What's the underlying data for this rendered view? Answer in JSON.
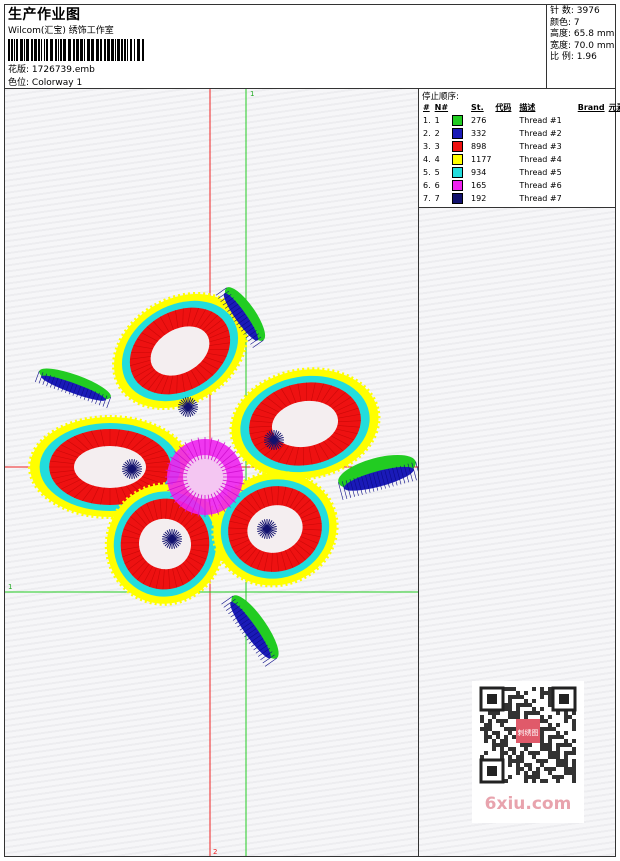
{
  "header": {
    "title": "生产作业图",
    "company": "Wilcom(汇宝) 绣饰工作室",
    "design_label": "花版:",
    "design_value": "1726739.emb",
    "color_label": "色位:",
    "color_value": "Colorway 1"
  },
  "stats": {
    "stitches_label": "针 数:",
    "stitches": "3976",
    "colors_label": "颜色:",
    "colors": "7",
    "height_label": "高度:",
    "height": "65.8 mm",
    "width_label": "宽度:",
    "width": "70.0 mm",
    "scale_label": "比 例:",
    "scale": "1.96"
  },
  "stop_sequence": {
    "title": "停止顺序:",
    "columns": [
      "#",
      "N#",
      "St.",
      "代码",
      "描述",
      "Brand",
      "元素"
    ],
    "rows": [
      {
        "n": "1.",
        "needle": "1",
        "color": "#22cc22",
        "stitches": "276",
        "desc": "Thread #1"
      },
      {
        "n": "2.",
        "needle": "2",
        "color": "#1a1ab8",
        "stitches": "332",
        "desc": "Thread #2"
      },
      {
        "n": "3.",
        "needle": "3",
        "color": "#ee1111",
        "stitches": "898",
        "desc": "Thread #3"
      },
      {
        "n": "4.",
        "needle": "4",
        "color": "#ffff00",
        "stitches": "1177",
        "desc": "Thread #4"
      },
      {
        "n": "5.",
        "needle": "5",
        "color": "#22dddd",
        "stitches": "934",
        "desc": "Thread #5"
      },
      {
        "n": "6.",
        "needle": "6",
        "color": "#ee22ee",
        "stitches": "165",
        "desc": "Thread #6"
      },
      {
        "n": "7.",
        "needle": "7",
        "color": "#12126e",
        "stitches": "192",
        "desc": "Thread #7"
      }
    ]
  },
  "guides": {
    "top_marker": "1",
    "right_marker": "2",
    "left_marker": "1",
    "bottom_marker": "2"
  },
  "watermark": {
    "text": "6xiu.com",
    "badge": "刺绣图"
  }
}
